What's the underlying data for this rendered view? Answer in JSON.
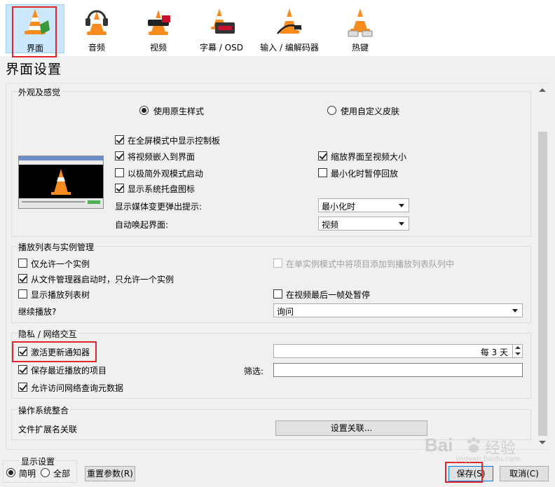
{
  "categories": [
    {
      "id": "interface",
      "label": "界面",
      "selected": true
    },
    {
      "id": "audio",
      "label": "音频"
    },
    {
      "id": "video",
      "label": "视频"
    },
    {
      "id": "subtitles",
      "label": "字幕 / OSD"
    },
    {
      "id": "input_codecs",
      "label": "输入 / 编解码器"
    },
    {
      "id": "hotkeys",
      "label": "热键"
    }
  ],
  "page_title": "界面设置",
  "look_feel": {
    "title": "外观及感觉",
    "native_style": "使用原生样式",
    "custom_skin": "使用自定义皮肤",
    "fullscreen_controller": "在全屏模式中显示控制板",
    "embed_video": "将视频嵌入到界面",
    "resize_interface": "缩放界面至视频大小",
    "minimal_start": "以极简外观模式启动",
    "pause_minimized": "最小化时暂停回放",
    "systray": "显示系统托盘图标",
    "media_popup_label": "显示媒体变更弹出提示:",
    "media_popup_value": "最小化时",
    "raise_label": "自动唤起界面:",
    "raise_value": "视频"
  },
  "playlist": {
    "title": "播放列表与实例管理",
    "one_instance": "仅允许一个实例",
    "enqueue_single": "在单实例模式中将项目添加到播放列表队列中",
    "one_instance_fm": "从文件管理器启动时，只允许一个实例",
    "show_tree": "显示播放列表树",
    "pause_last_frame": "在视频最后一帧处暂停",
    "continue_label": "继续播放?",
    "continue_value": "询问"
  },
  "privacy": {
    "title": "隐私 / 网络交互",
    "update_notifier": "激活更新通知器",
    "update_interval": "每 3 天",
    "save_recent": "保存最近播放的项目",
    "filter_label": "筛选:",
    "filter_value": "",
    "metadata": "允许访问网络查询元数据"
  },
  "os_integration": {
    "title": "操作系统整合",
    "file_ext_label": "文件扩展名关联",
    "set_assoc_button": "设置关联..."
  },
  "show_settings": {
    "title": "显示设置",
    "simple": "简明",
    "all": "全部"
  },
  "buttons": {
    "reset": "重置参数(R)",
    "save": "保存(S)",
    "cancel": "取消(C)"
  },
  "watermark": {
    "text": "Bai",
    "text2": "经验",
    "url": "jingyan.baidu.com"
  },
  "colors": {
    "highlight": "#e0262b",
    "selected_bg": "#cce8ff"
  }
}
